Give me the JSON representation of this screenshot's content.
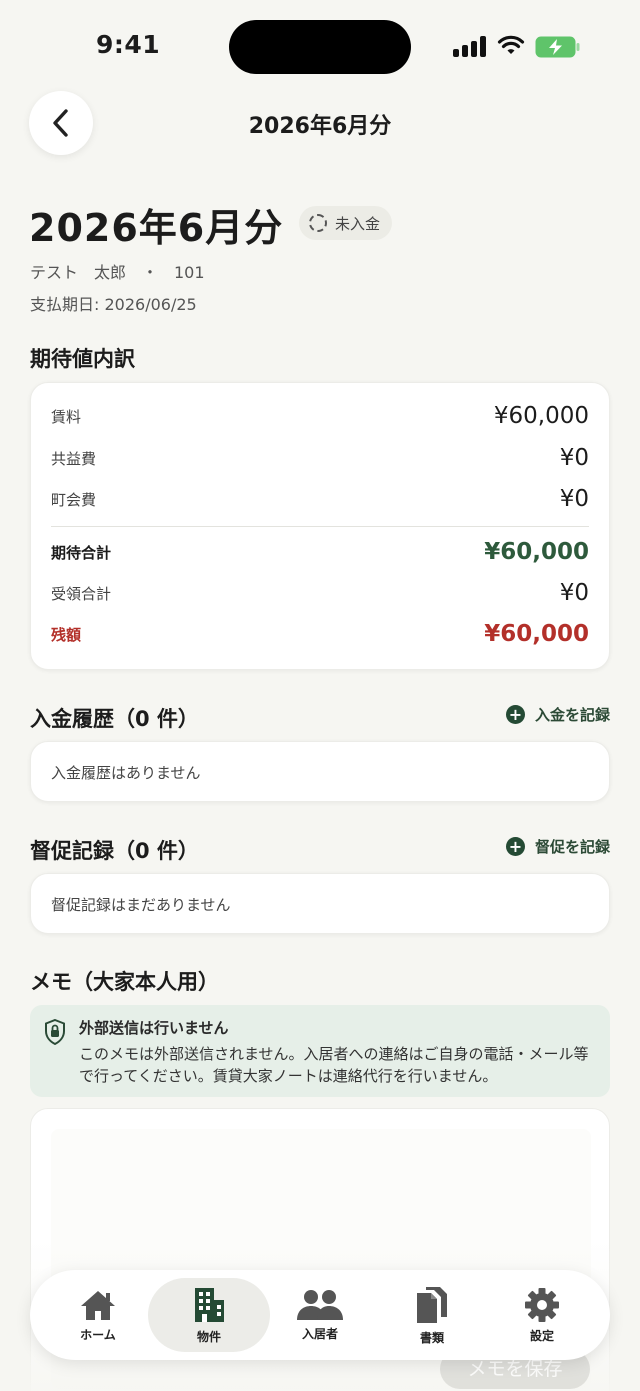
{
  "status_bar": {
    "time": "9:41"
  },
  "header": {
    "title": "2026年6月分"
  },
  "summary": {
    "title": "2026年6月分",
    "status_badge": "未入金",
    "tenant_unit": "テスト　太郎　・　101",
    "due_date": "支払期日: 2026/06/25"
  },
  "breakdown": {
    "title": "期待値内訳",
    "rows": [
      {
        "label": "賃料",
        "value": "¥60,000"
      },
      {
        "label": "共益費",
        "value": "¥0"
      },
      {
        "label": "町会費",
        "value": "¥0"
      }
    ],
    "expected_total": {
      "label": "期待合計",
      "value": "¥60,000"
    },
    "received_total": {
      "label": "受領合計",
      "value": "¥0"
    },
    "balance": {
      "label": "残額",
      "value": "¥60,000"
    }
  },
  "payments": {
    "title": "入金履歴（0 件）",
    "action": "入金を記録",
    "empty": "入金履歴はありません"
  },
  "reminders": {
    "title": "督促記録（0 件）",
    "action": "督促を記録",
    "empty": "督促記録はまだありません"
  },
  "memo": {
    "title": "メモ（大家本人用）",
    "notice_title": "外部送信は行いません",
    "notice_body": "このメモは外部送信されません。入居者への連絡はご自身の電話・メール等で行ってください。賃貸大家ノートは連絡代行を行いません。",
    "save_label": "メモを保存"
  },
  "tabs": [
    {
      "label": "ホーム",
      "icon": "home-icon"
    },
    {
      "label": "物件",
      "icon": "building-icon",
      "active": true
    },
    {
      "label": "入居者",
      "icon": "people-icon"
    },
    {
      "label": "書類",
      "icon": "documents-icon"
    },
    {
      "label": "設定",
      "icon": "gear-icon"
    }
  ],
  "colors": {
    "accent": "#2e5a3c",
    "danger": "#b3302a",
    "background": "#f6f6f2"
  }
}
